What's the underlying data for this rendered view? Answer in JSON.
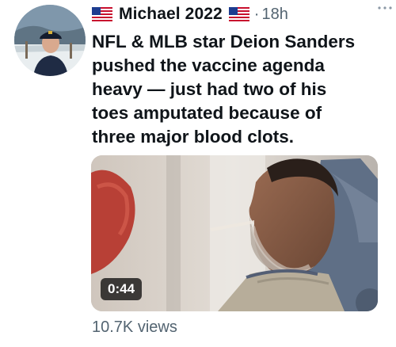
{
  "tweet": {
    "author_name": "Michael 2022",
    "separator": "·",
    "timestamp": "18h",
    "more_icon": "more-options-icon",
    "text": "NFL & MLB star Deion Sanders\npushed the vaccine agenda\nheavy — just had two of his\ntoes amputated because of\nthree major blood clots.",
    "media": {
      "type": "video",
      "duration": "0:44"
    },
    "views": "10.7K views"
  }
}
